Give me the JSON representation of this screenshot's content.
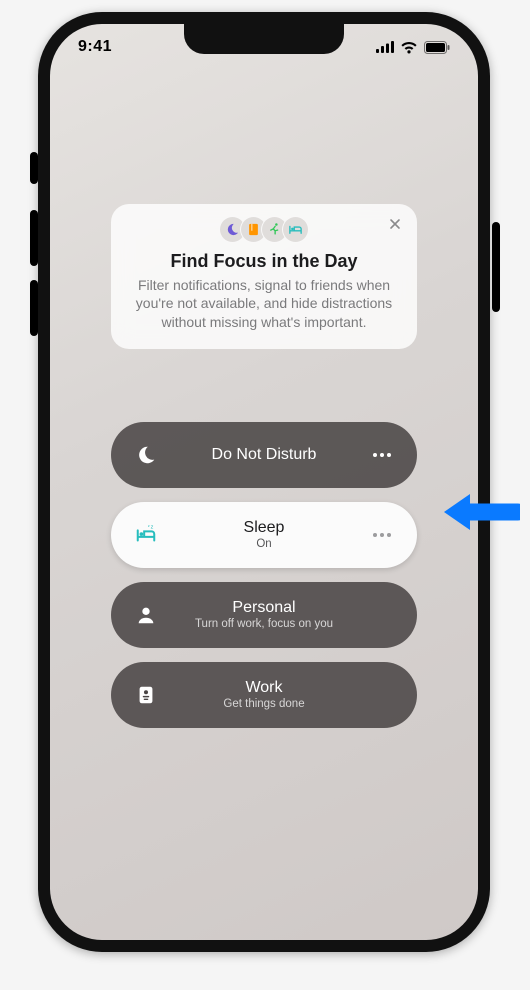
{
  "status": {
    "time": "9:41"
  },
  "tip": {
    "title": "Find Focus in the Day",
    "body": "Filter notifications, signal to friends when you're not available, and hide distractions without missing what's important."
  },
  "focus": [
    {
      "icon": "moon",
      "label": "Do Not Disturb",
      "sub": "",
      "active": false,
      "more": true
    },
    {
      "icon": "bed",
      "label": "Sleep",
      "sub": "On",
      "active": true,
      "more": true
    },
    {
      "icon": "person",
      "label": "Personal",
      "sub": "Turn off work, focus on you",
      "active": false,
      "more": false
    },
    {
      "icon": "badge",
      "label": "Work",
      "sub": "Get things done",
      "active": false,
      "more": false
    }
  ],
  "colors": {
    "moon": "#6e5bd6",
    "book": "#ff9500",
    "runner": "#34c759",
    "bed": "#27bdbd",
    "arrow": "#0a7aff"
  }
}
